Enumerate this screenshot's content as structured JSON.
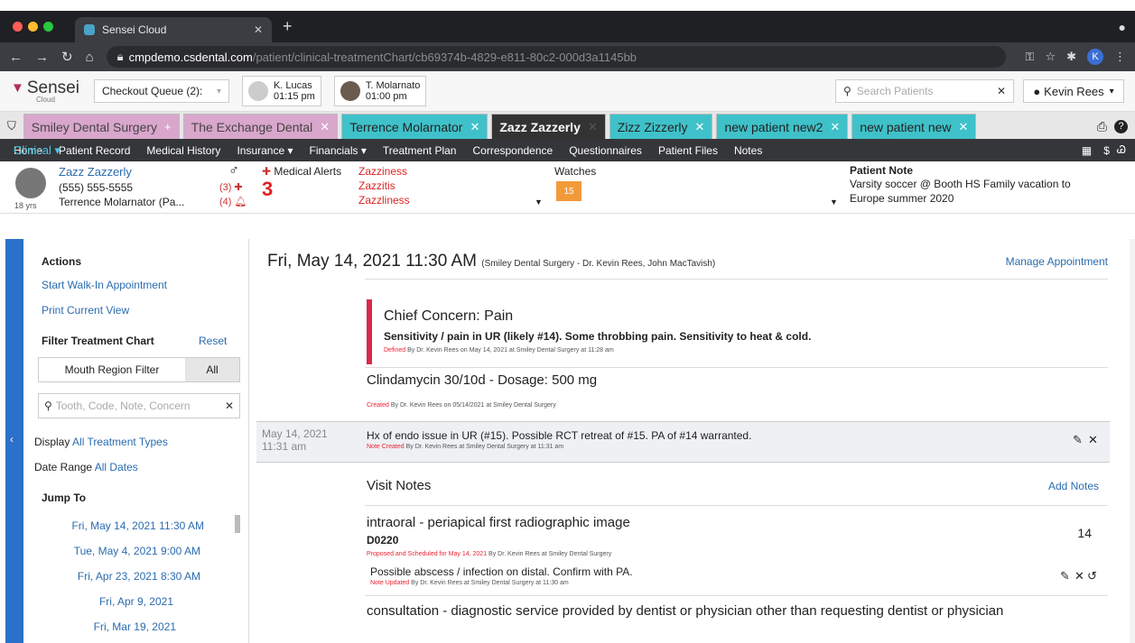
{
  "browser": {
    "tab_title": "Sensei Cloud",
    "url_host": "cmpdemo.csdental.com",
    "url_path": "/patient/clinical-treatmentChart/cb69374b-4829-e811-80c2-000d3a1145bb",
    "profile_initial": "K"
  },
  "header": {
    "brand": "Sensei",
    "brand_sub": "Cloud",
    "checkout_queue": "Checkout Queue (2):",
    "provider1_name": "K. Lucas",
    "provider1_time": "01:15 pm",
    "provider2_name": "T. Molarnato",
    "provider2_time": "01:00 pm",
    "search_placeholder": "Search Patients",
    "user": "Kevin Rees"
  },
  "patient_tabs": [
    {
      "label": "Smiley Dental Surgery"
    },
    {
      "label": "The Exchange Dental"
    },
    {
      "label": "Terrence Molarnator"
    },
    {
      "label": "Zazz Zazzerly"
    },
    {
      "label": "Zizz Zizzerly"
    },
    {
      "label": "new patient new2"
    },
    {
      "label": "new patient new"
    }
  ],
  "menu": [
    "Home",
    "Patient Record",
    "Medical History",
    "Insurance ▾",
    "Clinical ▾",
    "Financials ▾",
    "Treatment Plan",
    "Correspondence",
    "Questionnaires",
    "Patient Files",
    "Notes"
  ],
  "patient": {
    "name": "Zazz Zazzerly",
    "phone": "(555) 555-5555",
    "guarantor": "Terrence Molarnator (Pa...",
    "age": "18 yrs",
    "count3": "(3)",
    "count4": "(4)",
    "alerts_label": "Medical Alerts",
    "alert_count": "3",
    "alerts": [
      "Zazziness",
      "Zazzitis",
      "Zazzliness"
    ],
    "watches_label": "Watches",
    "watch_badge": "15",
    "note_label": "Patient Note",
    "note_text": "Varsity soccer @ Booth HS Family vacation to Europe summer 2020"
  },
  "sidebar": {
    "actions": "Actions",
    "walk_in": "Start Walk-In Appointment",
    "print": "Print Current View",
    "filter": "Filter Treatment Chart",
    "reset": "Reset",
    "region": "Mouth Region Filter",
    "all": "All",
    "search_placeholder": "Tooth, Code, Note, Concern",
    "display_label": "Display",
    "display_value": "All Treatment Types",
    "range_label": "Date Range",
    "range_value": "All Dates",
    "jump_to": "Jump To",
    "jumps": [
      "Fri, May 14, 2021 11:30 AM",
      "Tue, May 4, 2021 9:00 AM",
      "Fri, Apr 23, 2021 8:30 AM",
      "Fri, Apr 9, 2021",
      "Fri, Mar 19, 2021"
    ]
  },
  "visit": {
    "date": "Fri, May 14, 2021 11:30 AM",
    "location": "(Smiley Dental Surgery - Dr. Kevin Rees, John MacTavish)",
    "manage": "Manage Appointment",
    "cc_title": "Chief Concern: Pain",
    "cc_desc": "Sensitivity / pain in UR (likely #14). Some throbbing pain. Sensitivity to heat & cold.",
    "cc_meta_r": "Defined",
    "cc_meta": "By Dr. Kevin Rees on May 14, 2021 at Smiley Dental Surgery at 11:28 am",
    "rx": "Clindamycin 30/10d - Dosage: 500 mg",
    "rx_meta_r": "Created",
    "rx_meta": "By Dr. Kevin Rees on 05/14/2021 at Smiley Dental Surgery",
    "note_date": "May 14, 2021",
    "note_time": "11:31 am",
    "note_text": "Hx of endo issue in UR (#15). Possible RCT retreat of #15. PA of #14 warranted.",
    "note_meta_r": "Note Created",
    "note_meta": "By Dr. Kevin Rees at Smiley Dental Surgery at 11:31 am",
    "visit_notes": "Visit Notes",
    "add_notes": "Add Notes",
    "proc1": "intraoral - periapical first radiographic image",
    "proc1_code": "D0220",
    "proc1_meta_r": "Proposed and Scheduled for May 14, 2021",
    "proc1_meta": "By Dr. Kevin Rees at Smiley Dental Surgery",
    "proc1_tooth": "14",
    "proc1_note": "Possible abscess / infection on distal. Confirm with PA.",
    "proc1_note_meta_r": "Note Updated",
    "proc1_note_meta": "By Dr. Kevin Rees at Smiley Dental Surgery at 11:30 am",
    "proc2": "consultation - diagnostic service provided by dentist or physician other than requesting dentist or physician"
  }
}
